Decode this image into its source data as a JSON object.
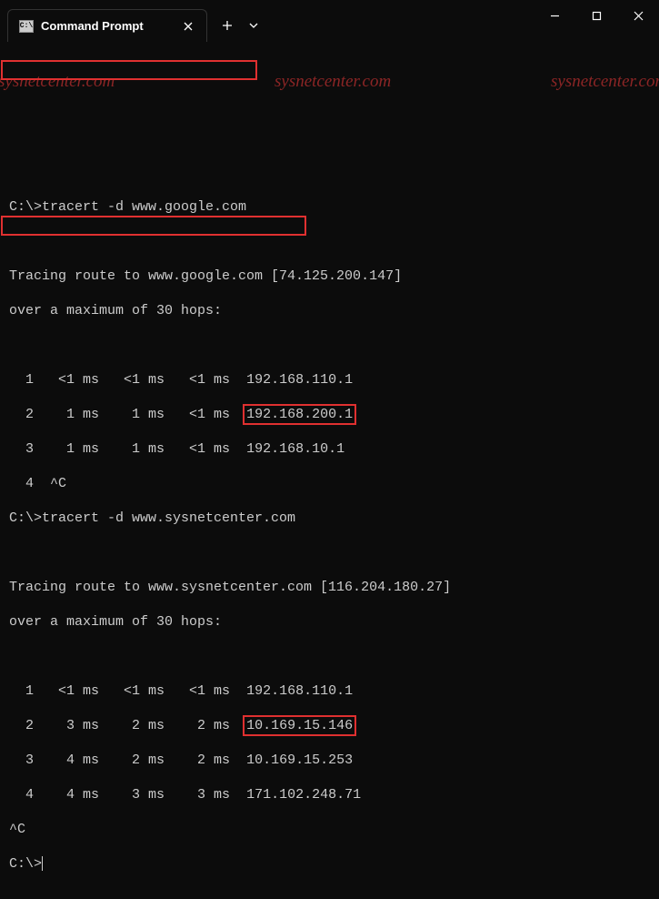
{
  "titlebar": {
    "tab_title": "Command Prompt",
    "tab_icon_text": "C:\\"
  },
  "watermark": "sysnetcenter.com",
  "terminal": {
    "prompt": "C:\\>",
    "cmd1": "tracert -d www.google.com",
    "trace1_header": "Tracing route to www.google.com [74.125.200.147]",
    "max_hops": "over a maximum of 30 hops:",
    "t1": {
      "r1": {
        "n": "  1",
        "a": "   <1 ms",
        "b": "   <1 ms",
        "c": "   <1 ms",
        "ip": "192.168.110.1"
      },
      "r2": {
        "n": "  2",
        "a": "    1 ms",
        "b": "    1 ms",
        "c": "   <1 ms",
        "ip": "192.168.200.1"
      },
      "r3": {
        "n": "  3",
        "a": "    1 ms",
        "b": "    1 ms",
        "c": "   <1 ms",
        "ip": "192.168.10.1"
      },
      "r4": {
        "n": "  4",
        "a": "  ^C",
        "b": "",
        "c": "",
        "ip": ""
      }
    },
    "cmd2": "tracert -d www.sysnetcenter.com",
    "trace2_header": "Tracing route to www.sysnetcenter.com [116.204.180.27]",
    "t2": {
      "r1": {
        "n": "  1",
        "a": "   <1 ms",
        "b": "   <1 ms",
        "c": "   <1 ms",
        "ip": "192.168.110.1"
      },
      "r2": {
        "n": "  2",
        "a": "    3 ms",
        "b": "    2 ms",
        "c": "    2 ms",
        "ip": "10.169.15.146"
      },
      "r3": {
        "n": "  3",
        "a": "    4 ms",
        "b": "    2 ms",
        "c": "    2 ms",
        "ip": "10.169.15.253"
      },
      "r4": {
        "n": "  4",
        "a": "    4 ms",
        "b": "    3 ms",
        "c": "    3 ms",
        "ip": "171.102.248.71"
      }
    },
    "ctrlc": "^C"
  }
}
